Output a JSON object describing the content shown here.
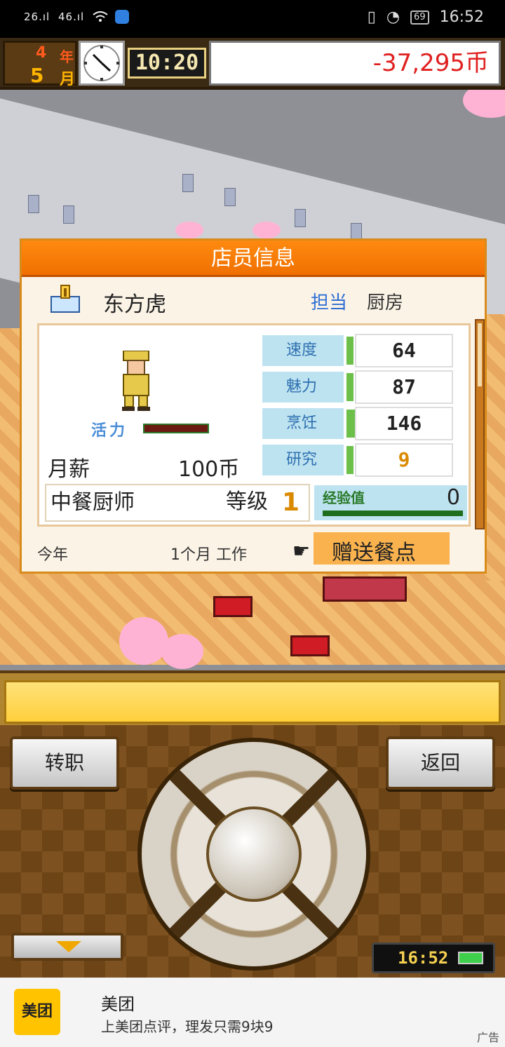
{
  "status_bar": {
    "net1": "26.ıl",
    "net2": "46.ıl",
    "battery": "69",
    "time": "16:52"
  },
  "hud": {
    "year_value": "4",
    "year_label": "年",
    "month_value": "5",
    "month_label": "月",
    "game_time": "10:20",
    "money": "-37,295币"
  },
  "dialog": {
    "title": "店员信息",
    "employee_name": "东方虎",
    "role_label": "担当",
    "role_value": "厨房",
    "vitality_label": "活力",
    "salary_label": "月薪",
    "salary_value": "100币",
    "stats": [
      {
        "name": "速度",
        "value": "64"
      },
      {
        "name": "魅力",
        "value": "87"
      },
      {
        "name": "烹饪",
        "value": "146"
      },
      {
        "name": "研究",
        "value": "9"
      }
    ],
    "job_title": "中餐厨师",
    "level_label": "等级",
    "level_value": "1",
    "exp_label": "经验值",
    "exp_value": "0",
    "year_label": "今年",
    "tenure": "1个月 工作",
    "gift_label": "赠送餐点"
  },
  "controls": {
    "transfer_label": "转职",
    "back_label": "返回",
    "clock": "16:52"
  },
  "ad": {
    "logo_text": "美团",
    "title": "美团",
    "subtitle": "上美团点评，理发只需9块9",
    "tag": "广告"
  },
  "colors": {
    "accent_orange": "#f07000",
    "money_red": "#e02020",
    "stat_blue": "#bde3f0",
    "stat_bar_green": "#6cc04a"
  }
}
